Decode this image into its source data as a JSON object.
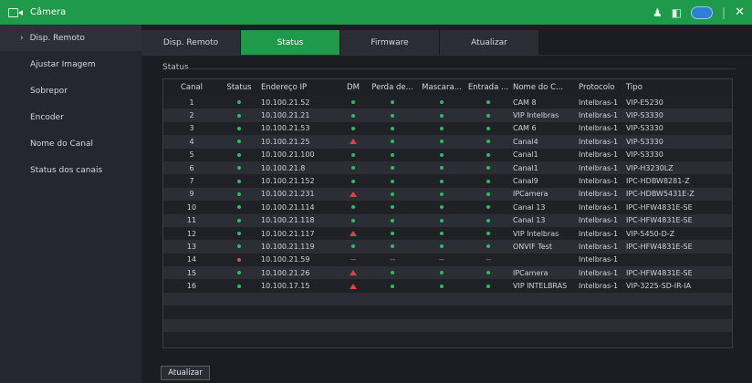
{
  "titlebar": {
    "title": "Câmera",
    "icons": [
      "camera-icon",
      "user-settings-icon",
      "exit-icon",
      "cloud-icon",
      "close-icon"
    ],
    "accent": "#1f9a4a"
  },
  "sidebar": {
    "items": [
      {
        "label": "Disp. Remoto",
        "active": true
      },
      {
        "label": "Ajustar Imagem"
      },
      {
        "label": "Sobrepor"
      },
      {
        "label": "Encoder"
      },
      {
        "label": "Nome do Canal"
      },
      {
        "label": "Status dos canais"
      }
    ]
  },
  "tabs": [
    {
      "label": "Disp. Remoto"
    },
    {
      "label": "Status",
      "active": true
    },
    {
      "label": "Firmware"
    },
    {
      "label": "Atualizar"
    }
  ],
  "section": {
    "label": "Status"
  },
  "table": {
    "headers": [
      "Canal",
      "Status",
      "Endereço IP",
      "DM",
      "Perda de...",
      "Mascara...",
      "Entrada ...",
      "Nome do C...",
      "Protocolo",
      "Tipo"
    ],
    "rows": [
      {
        "canal": "1",
        "status": "ok",
        "ip": "10.100.21.52",
        "dm": "ok",
        "perda": "ok",
        "mascara": "ok",
        "entrada": "ok",
        "nome": "CAM 8",
        "protocolo": "Intelbras-1",
        "tipo": "VIP-E5230"
      },
      {
        "canal": "2",
        "status": "ok",
        "ip": "10.100.21.21",
        "dm": "ok",
        "perda": "ok",
        "mascara": "ok",
        "entrada": "ok",
        "nome": "VIP Intelbras",
        "protocolo": "Intelbras-1",
        "tipo": "VIP-S3330"
      },
      {
        "canal": "3",
        "status": "ok",
        "ip": "10.100.21.53",
        "dm": "ok",
        "perda": "ok",
        "mascara": "ok",
        "entrada": "ok",
        "nome": "CAM 6",
        "protocolo": "Intelbras-1",
        "tipo": "VIP-S3330"
      },
      {
        "canal": "4",
        "status": "ok",
        "ip": "10.100.21.25",
        "dm": "alert",
        "perda": "ok",
        "mascara": "ok",
        "entrada": "ok",
        "nome": "Canal4",
        "protocolo": "Intelbras-1",
        "tipo": "VIP-S3330"
      },
      {
        "canal": "5",
        "status": "ok",
        "ip": "10.100.21.100",
        "dm": "ok",
        "perda": "ok",
        "mascara": "ok",
        "entrada": "ok",
        "nome": "Canal1",
        "protocolo": "Intelbras-1",
        "tipo": "VIP-S3330"
      },
      {
        "canal": "6",
        "status": "ok",
        "ip": "10.100.21.8",
        "dm": "ok",
        "perda": "ok",
        "mascara": "ok",
        "entrada": "ok",
        "nome": "Canal1",
        "protocolo": "Intelbras-1",
        "tipo": "VIP-H3230LZ"
      },
      {
        "canal": "7",
        "status": "ok",
        "ip": "10.100.21.152",
        "dm": "ok",
        "perda": "ok",
        "mascara": "ok",
        "entrada": "ok",
        "nome": "Canal9",
        "protocolo": "Intelbras-1",
        "tipo": "IPC-HDBW8281-Z"
      },
      {
        "canal": "9",
        "status": "ok",
        "ip": "10.100.21.231",
        "dm": "alert",
        "perda": "ok",
        "mascara": "ok",
        "entrada": "ok",
        "nome": "IPCamera",
        "protocolo": "Intelbras-1",
        "tipo": "IPC-HDBW5431E-Z"
      },
      {
        "canal": "10",
        "status": "ok",
        "ip": "10.100.21.114",
        "dm": "ok",
        "perda": "ok",
        "mascara": "ok",
        "entrada": "ok",
        "nome": "Canal 13",
        "protocolo": "Intelbras-1",
        "tipo": "IPC-HFW4831E-SE"
      },
      {
        "canal": "11",
        "status": "ok",
        "ip": "10.100.21.118",
        "dm": "ok",
        "perda": "ok",
        "mascara": "ok",
        "entrada": "ok",
        "nome": "Canal 13",
        "protocolo": "Intelbras-1",
        "tipo": "IPC-HFW4831E-SE"
      },
      {
        "canal": "12",
        "status": "ok",
        "ip": "10.100.21.117",
        "dm": "alert",
        "perda": "ok",
        "mascara": "ok",
        "entrada": "ok",
        "nome": "VIP Intelbras",
        "protocolo": "Intelbras-1",
        "tipo": "VIP-5450-D-Z"
      },
      {
        "canal": "13",
        "status": "ok",
        "ip": "10.100.21.119",
        "dm": "ok",
        "perda": "ok",
        "mascara": "ok",
        "entrada": "ok",
        "nome": "ONVIF Test",
        "protocolo": "Intelbras-1",
        "tipo": "IPC-HFW4831E-SE"
      },
      {
        "canal": "14",
        "status": "offline",
        "ip": "10.100.21.59",
        "dm": "--",
        "perda": "--",
        "mascara": "--",
        "entrada": "--",
        "nome": "",
        "protocolo": "Intelbras-1",
        "tipo": ""
      },
      {
        "canal": "15",
        "status": "ok",
        "ip": "10.100.21.26",
        "dm": "alert",
        "perda": "ok",
        "mascara": "ok",
        "entrada": "ok",
        "nome": "IPCamera",
        "protocolo": "Intelbras-1",
        "tipo": "IPC-HFW4831E-SE"
      },
      {
        "canal": "16",
        "status": "ok",
        "ip": "10.100.17.15",
        "dm": "alert",
        "perda": "ok",
        "mascara": "ok",
        "entrada": "ok",
        "nome": "VIP INTELBRAS",
        "protocolo": "Intelbras-1",
        "tipo": "VIP-3225-SD-IR-IA"
      }
    ],
    "empty_rows": 4,
    "status_colors": {
      "ok": "#25c060",
      "offline": "#e35150",
      "alert": "#e0433f"
    }
  },
  "footer": {
    "refresh_label": "Atualizar"
  }
}
